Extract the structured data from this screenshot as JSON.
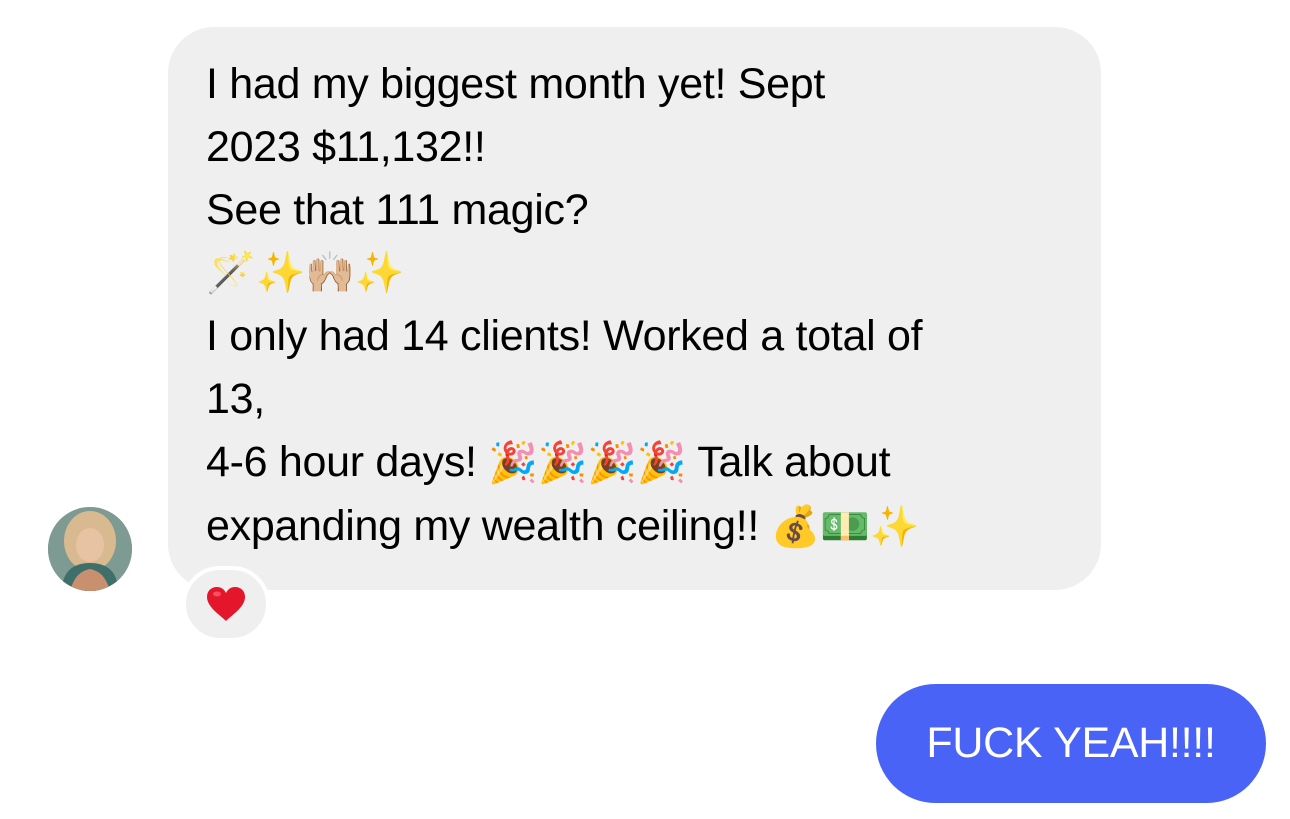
{
  "conversation": {
    "received": {
      "lines": [
        "I had my biggest month yet!    Sept",
        "2023 $11,132!!",
        "See that 111 magic?",
        "",
        "I only had 14 clients! Worked a total of",
        "13,",
        "4-6 hour days!",
        "Talk about",
        "expanding my wealth ceiling!!"
      ],
      "emojis_row": "🪄✨🙌🏼✨",
      "party_emojis": "🎉🎉🎉🎉",
      "wealth_emojis": "💰💵✨",
      "reaction": "❤️"
    },
    "sent": {
      "text": "FUCK YEAH!!!!"
    }
  },
  "colors": {
    "incoming_bubble": "#efefef",
    "outgoing_bubble": "#4a63f7",
    "outgoing_text": "#ffffff",
    "reaction_heart": "#e3162b"
  },
  "icons": {
    "avatar": "profile-photo",
    "reaction": "heart-icon"
  }
}
